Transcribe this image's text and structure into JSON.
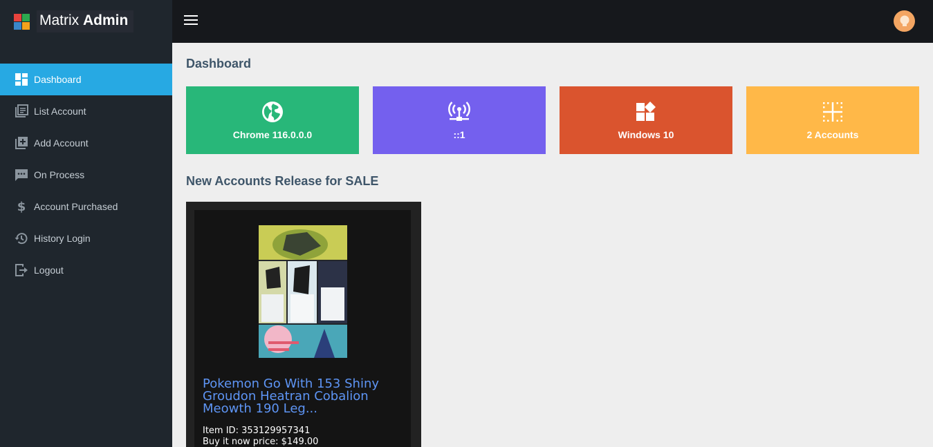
{
  "brand": {
    "name_light": "Matrix",
    "name_bold": "Admin",
    "logo_colors": [
      "#2da84f",
      "#e8433d",
      "#f3a21c",
      "#3a86c8"
    ]
  },
  "sidebar": {
    "items": [
      {
        "label": "Dashboard",
        "icon": "dashboard-icon",
        "active": true
      },
      {
        "label": "List Account",
        "icon": "list-icon",
        "active": false
      },
      {
        "label": "Add Account",
        "icon": "add-box-icon",
        "active": false
      },
      {
        "label": "On Process",
        "icon": "message-processing-icon",
        "active": false
      },
      {
        "label": "Account Purchased",
        "icon": "dollar-icon",
        "active": false
      },
      {
        "label": "History Login",
        "icon": "history-icon",
        "active": false
      },
      {
        "label": "Logout",
        "icon": "logout-icon",
        "active": false
      }
    ]
  },
  "main": {
    "title": "Dashboard",
    "stats": [
      {
        "label": "Chrome 116.0.0.0",
        "icon": "globe-icon",
        "color": "#28b779"
      },
      {
        "label": "::1",
        "icon": "access-point-network-icon",
        "color": "#7460ee"
      },
      {
        "label": "Windows 10",
        "icon": "windows-widgets-icon",
        "color": "#da542e"
      },
      {
        "label": "2 Accounts",
        "icon": "border-grid-icon",
        "color": "#ffb848"
      }
    ],
    "section_title": "New Accounts Release for SALE",
    "listing": {
      "title": "Pokemon Go With 153 Shiny Groudon Heatran Cobalion Meowth 190 Leg...",
      "item_id": "Item ID: 353129957341",
      "price": "Buy it now price: $149.00"
    }
  },
  "colors": {
    "sidebar_bg": "#1f262d",
    "topbar_bg": "#16181c",
    "active_item": "#27a9e3",
    "link": "#5e95f5"
  }
}
